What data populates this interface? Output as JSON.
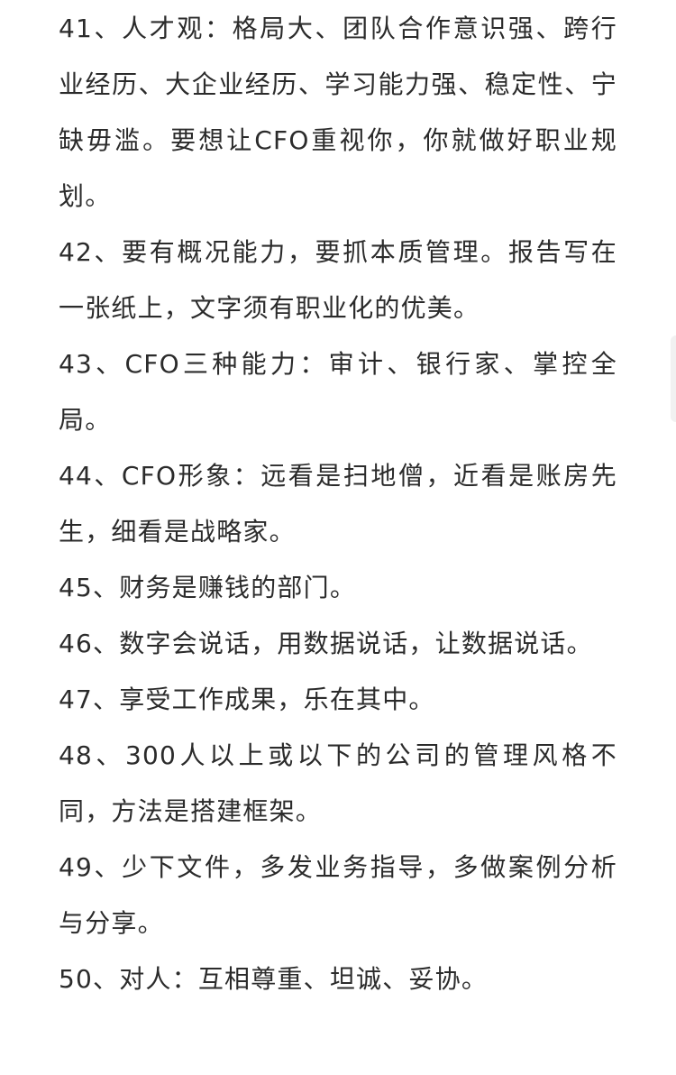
{
  "paragraphs": [
    "41、人才观：格局大、团队合作意识强、跨行业经历、大企业经历、学习能力强、稳定性、宁缺毋滥。要想让CFO重视你，你就做好职业规划。",
    "42、要有概况能力，要抓本质管理。报告写在一张纸上，文字须有职业化的优美。",
    "43、CFO三种能力：审计、银行家、掌控全局。",
    "44、CFO形象：远看是扫地僧，近看是账房先生，细看是战略家。",
    "45、财务是赚钱的部门。",
    "46、数字会说话，用数据说话，让数据说话。",
    "47、享受工作成果，乐在其中。",
    "48、300人以上或以下的公司的管理风格不同，方法是搭建框架。",
    "49、少下文件，多发业务指导，多做案例分析与分享。",
    "50、对人：互相尊重、坦诚、妥协。"
  ]
}
